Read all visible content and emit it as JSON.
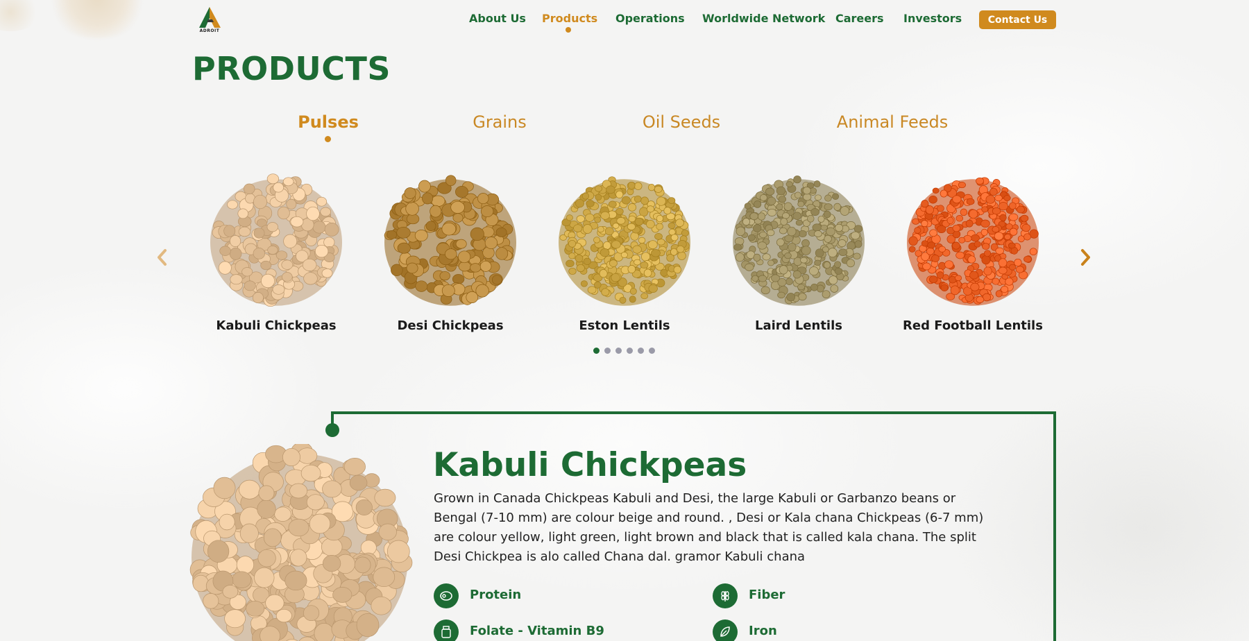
{
  "header": {
    "logo_text": "ADROIT",
    "nav": [
      {
        "label": "About Us",
        "active": false
      },
      {
        "label": "Products",
        "active": true
      },
      {
        "label": "Operations",
        "active": false
      },
      {
        "label": "Worldwide Network",
        "active": false
      },
      {
        "label": "Careers",
        "active": false
      },
      {
        "label": "Investors",
        "active": false
      }
    ],
    "contact_label": "Contact Us"
  },
  "page_title": "PRODUCTS",
  "categories": [
    {
      "label": "Pulses",
      "active": true
    },
    {
      "label": "Grains",
      "active": false
    },
    {
      "label": "Oil Seeds",
      "active": false
    },
    {
      "label": "Animal Feeds",
      "active": false
    }
  ],
  "carousel": {
    "products": [
      {
        "name": "Kabuli Chickpeas",
        "color": "#e6c39a"
      },
      {
        "name": "Desi Chickpeas",
        "color": "#b98a3f"
      },
      {
        "name": "Eston Lentils",
        "color": "#d2ac4b"
      },
      {
        "name": "Laird Lentils",
        "color": "#a99a6b"
      },
      {
        "name": "Red Football Lentils",
        "color": "#f0662a"
      }
    ],
    "pages": 6,
    "active_page": 1
  },
  "detail": {
    "title": "Kabuli Chickpeas",
    "description": "Grown in Canada Chickpeas Kabuli and Desi, the large Kabuli or Garbanzo beans or Bengal (7-10 mm) are colour beige and round. , Desi or Kala chana Chickpeas (6-7 mm) are colour yellow, light green, light brown and black that is called kala chana. The split Desi Chickpea is alo called Chana dal. gramor Kabuli chana",
    "nutrients": [
      {
        "label": "Protein",
        "icon": "meat-icon"
      },
      {
        "label": "Fiber",
        "icon": "wheat-icon"
      },
      {
        "label": "Folate - Vitamin B9",
        "icon": "vitamin-icon"
      },
      {
        "label": "Iron",
        "icon": "leaf-icon"
      }
    ]
  },
  "colors": {
    "brand_green": "#1d6b34",
    "brand_orange": "#d08a1e",
    "background": "#f4f4f3"
  }
}
